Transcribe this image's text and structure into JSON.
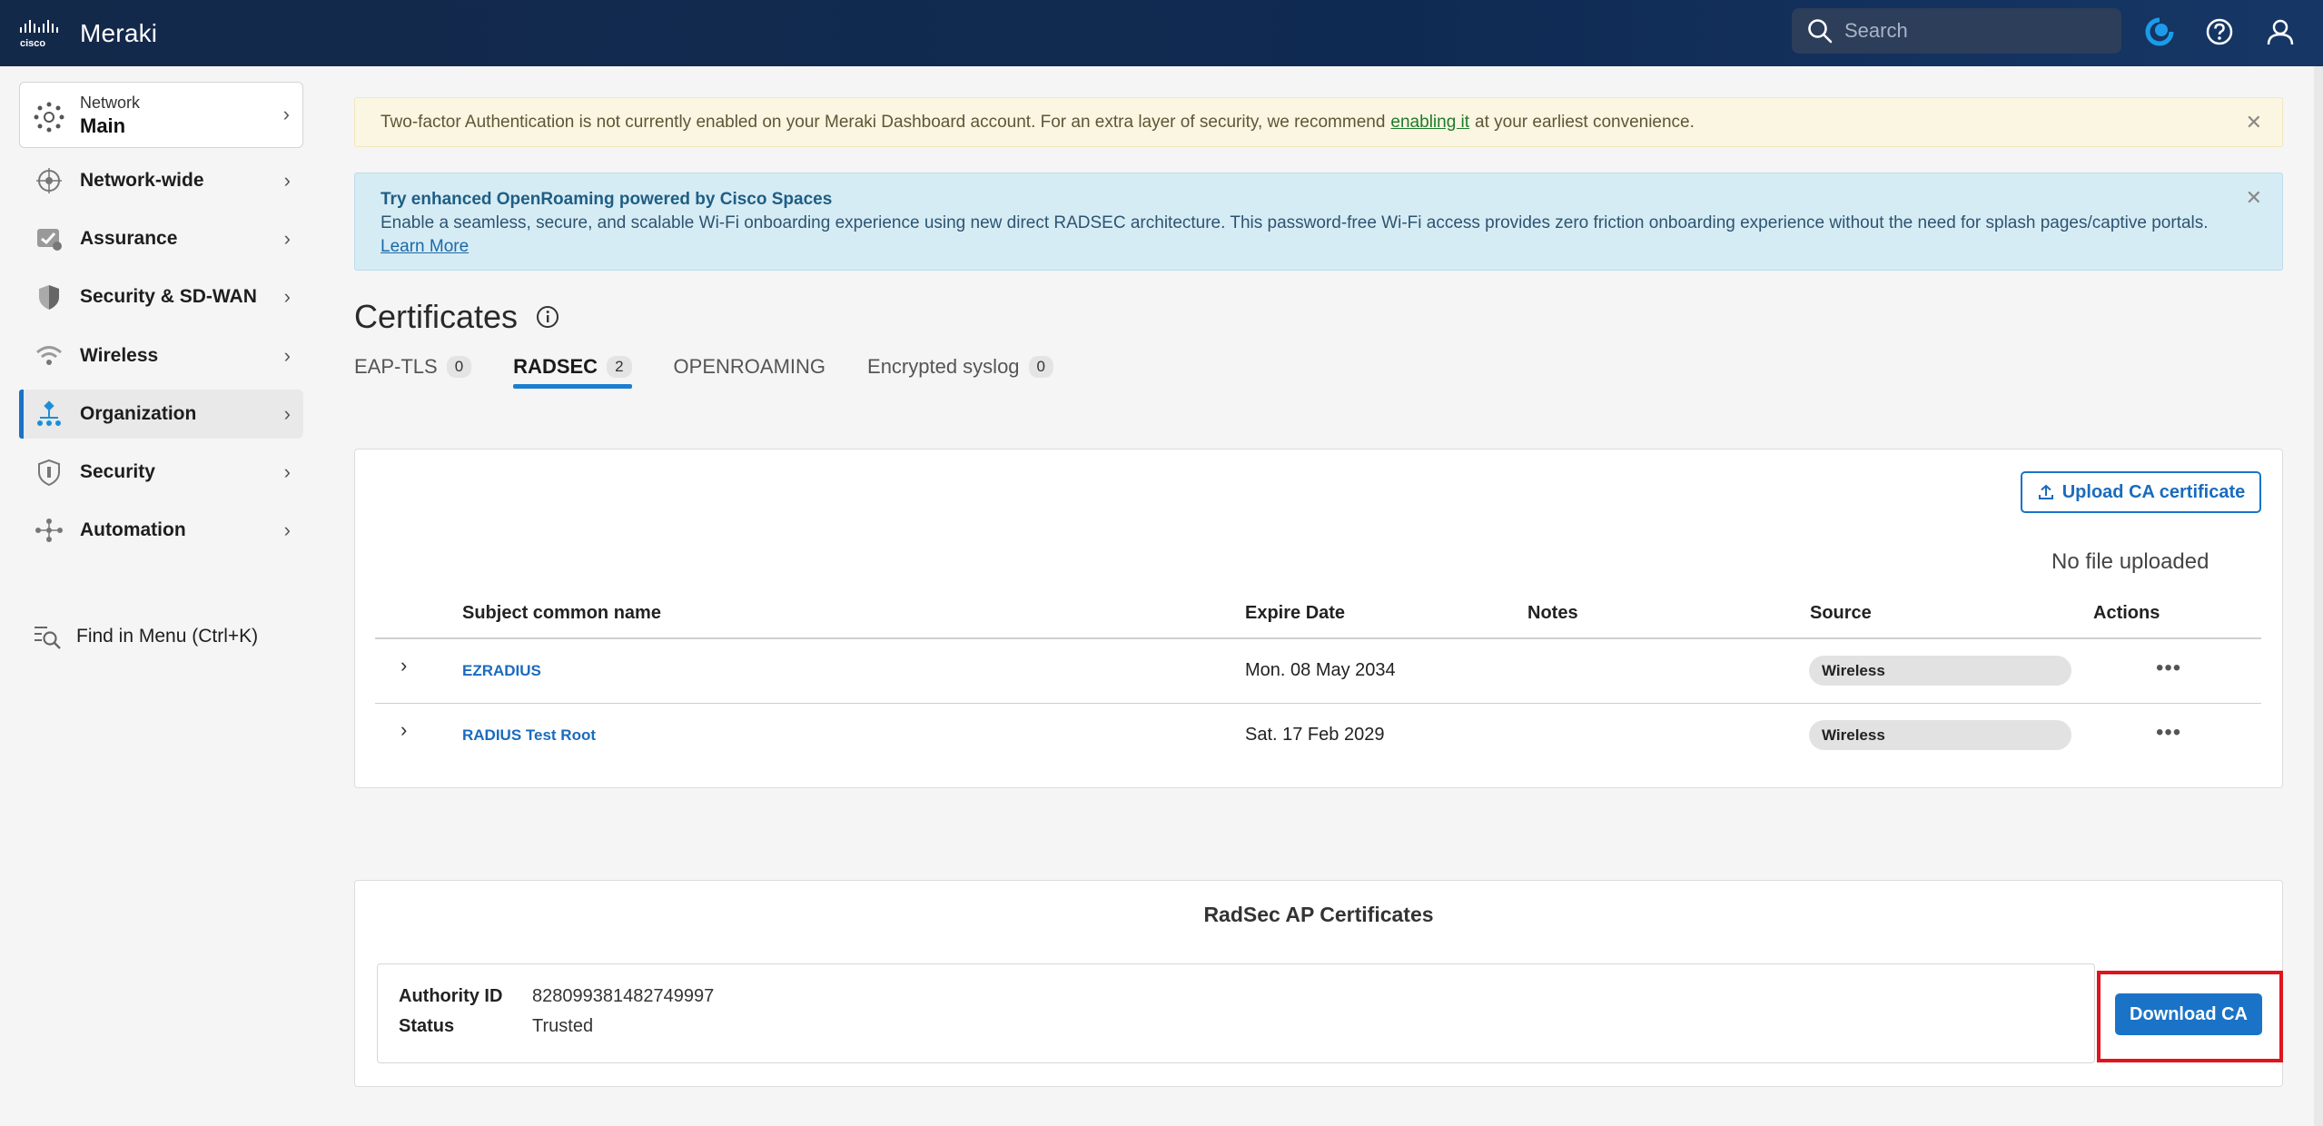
{
  "app": {
    "brand": "Meraki"
  },
  "topbar": {
    "search_placeholder": "Search",
    "icons": [
      "cisco-logo-icon",
      "search-icon",
      "spaces-icon",
      "help-icon",
      "user-icon"
    ]
  },
  "sidebar": {
    "network_label": "Network",
    "network_name": "Main",
    "items": [
      {
        "label": "Network-wide",
        "icon": "network-wide-icon"
      },
      {
        "label": "Assurance",
        "icon": "assurance-icon"
      },
      {
        "label": "Security & SD-WAN",
        "icon": "shield-half-icon"
      },
      {
        "label": "Wireless",
        "icon": "wifi-icon"
      },
      {
        "label": "Organization",
        "icon": "organization-icon",
        "active": true
      },
      {
        "label": "Security",
        "icon": "shield-icon"
      },
      {
        "label": "Automation",
        "icon": "automation-icon"
      }
    ],
    "find_menu": "Find in Menu (Ctrl+K)"
  },
  "banners": {
    "two_factor": {
      "text_before": "Two-factor Authentication is not currently enabled on your Meraki Dashboard account. For an extra layer of security, we recommend",
      "link": "enabling it",
      "text_after": "at your earliest convenience."
    },
    "openroaming": {
      "title": "Try enhanced OpenRoaming powered by Cisco Spaces",
      "body": "Enable a seamless, secure, and scalable Wi-Fi onboarding experience using new direct RADSEC architecture. This password-free Wi-Fi access provides zero friction onboarding experience without the need for splash pages/captive portals.",
      "link": "Learn More"
    }
  },
  "page": {
    "title": "Certificates",
    "tabs": [
      {
        "label": "EAP-TLS",
        "count": "0"
      },
      {
        "label": "RADSEC",
        "count": "2",
        "active": true
      },
      {
        "label": "OPENROAMING"
      },
      {
        "label": "Encrypted syslog",
        "count": "0"
      }
    ]
  },
  "certs": {
    "upload_label": "Upload CA certificate",
    "no_file": "No file uploaded",
    "columns": [
      "Subject common name",
      "Expire Date",
      "Notes",
      "Source",
      "Actions"
    ],
    "rows": [
      {
        "name": "EZRADIUS",
        "expire": "Mon. 08 May 2034",
        "notes": "",
        "source": "Wireless",
        "actions": "•••"
      },
      {
        "name": "RADIUS Test Root",
        "expire": "Sat. 17 Feb 2029",
        "notes": "",
        "source": "Wireless",
        "actions": "•••"
      }
    ]
  },
  "radsec": {
    "title": "RadSec AP Certificates",
    "authority_label": "Authority ID",
    "authority_value": "828099381482749997",
    "status_label": "Status",
    "status_value": "Trusted",
    "download_label": "Download CA"
  },
  "colors": {
    "topbar": "#13294a",
    "accent": "#1a73c7",
    "highlight": "#e0141e",
    "warn_bg": "#fbf6e1",
    "info_bg": "#d6ecf5"
  }
}
